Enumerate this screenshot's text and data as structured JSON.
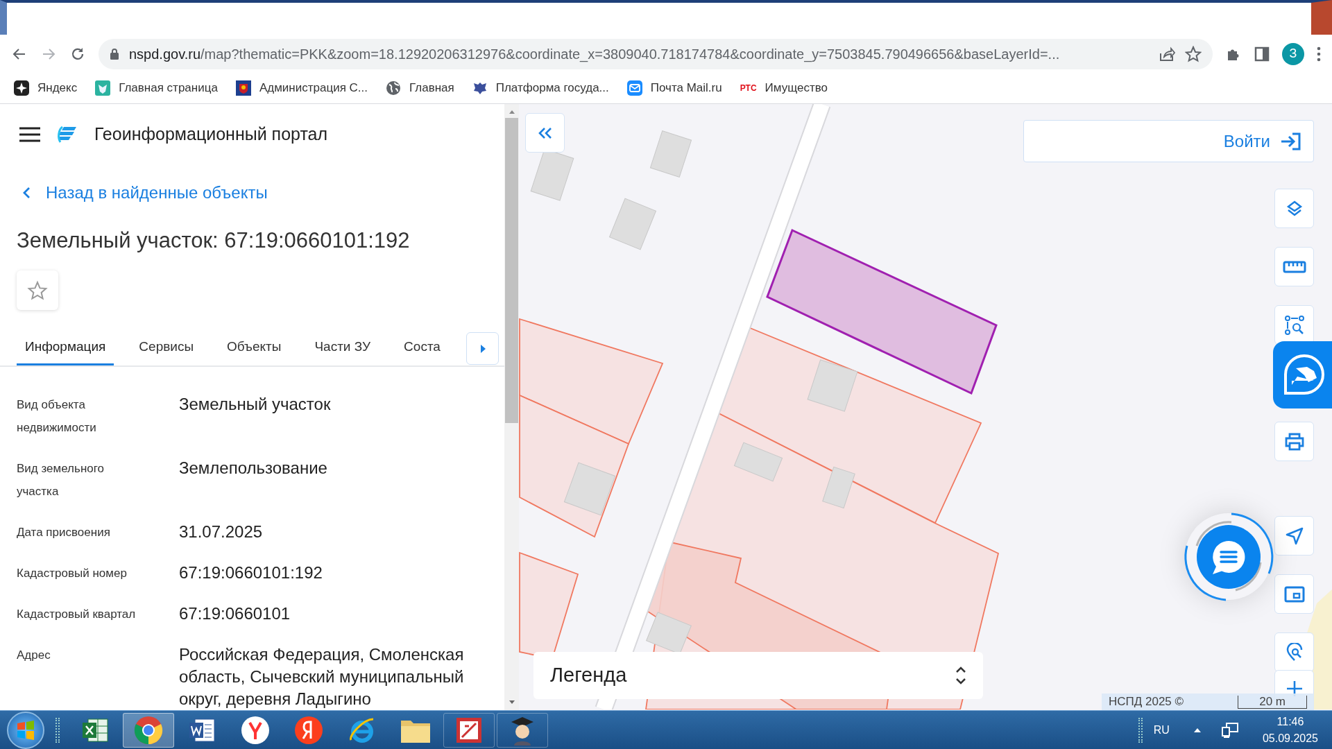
{
  "browser": {
    "url_host": "nspd.gov.ru",
    "url_path": "/map?thematic=PKK&zoom=18.12920206312976&coordinate_x=3809040.718174784&coordinate_y=7503845.790496656&baseLayerId=...",
    "profile_initial": "З",
    "bookmarks": [
      {
        "label": "Яндекс"
      },
      {
        "label": "Главная страница"
      },
      {
        "label": "Администрация С..."
      },
      {
        "label": "Главная"
      },
      {
        "label": "Платформа госуда..."
      },
      {
        "label": "Почта Mail.ru"
      },
      {
        "label": "Имущество",
        "logo_text": "РТС"
      }
    ]
  },
  "panel": {
    "app_title": "Геоинформационный портал",
    "back_link": "Назад в найденные объекты",
    "heading": "Земельный участок: 67:19:0660101:192",
    "tabs": [
      {
        "label": "Информация",
        "selected": true
      },
      {
        "label": "Сервисы",
        "selected": false
      },
      {
        "label": "Объекты",
        "selected": false
      },
      {
        "label": "Части ЗУ",
        "selected": false
      },
      {
        "label": "Соста",
        "selected": false
      }
    ],
    "fields": [
      {
        "label": "Вид объекта недвижимости",
        "value": "Земельный участок"
      },
      {
        "label": "Вид земельного участка",
        "value": "Землепользование"
      },
      {
        "label": "Дата присвоения",
        "value": "31.07.2025"
      },
      {
        "label": "Кадастровый номер",
        "value": "67:19:0660101:192"
      },
      {
        "label": "Кадастровый квартал",
        "value": "67:19:0660101"
      },
      {
        "label": "Адрес",
        "value": "Российская Федерация, Смоленская область, Сычевский муниципальный округ, деревня Ладыгино"
      }
    ]
  },
  "map": {
    "login": "Войти",
    "legend": "Легенда",
    "attribution": "НСПД 2025 ©",
    "scale": "20 m"
  },
  "taskbar": {
    "language": "RU",
    "time": "11:46",
    "date": "05.09.2025"
  }
}
